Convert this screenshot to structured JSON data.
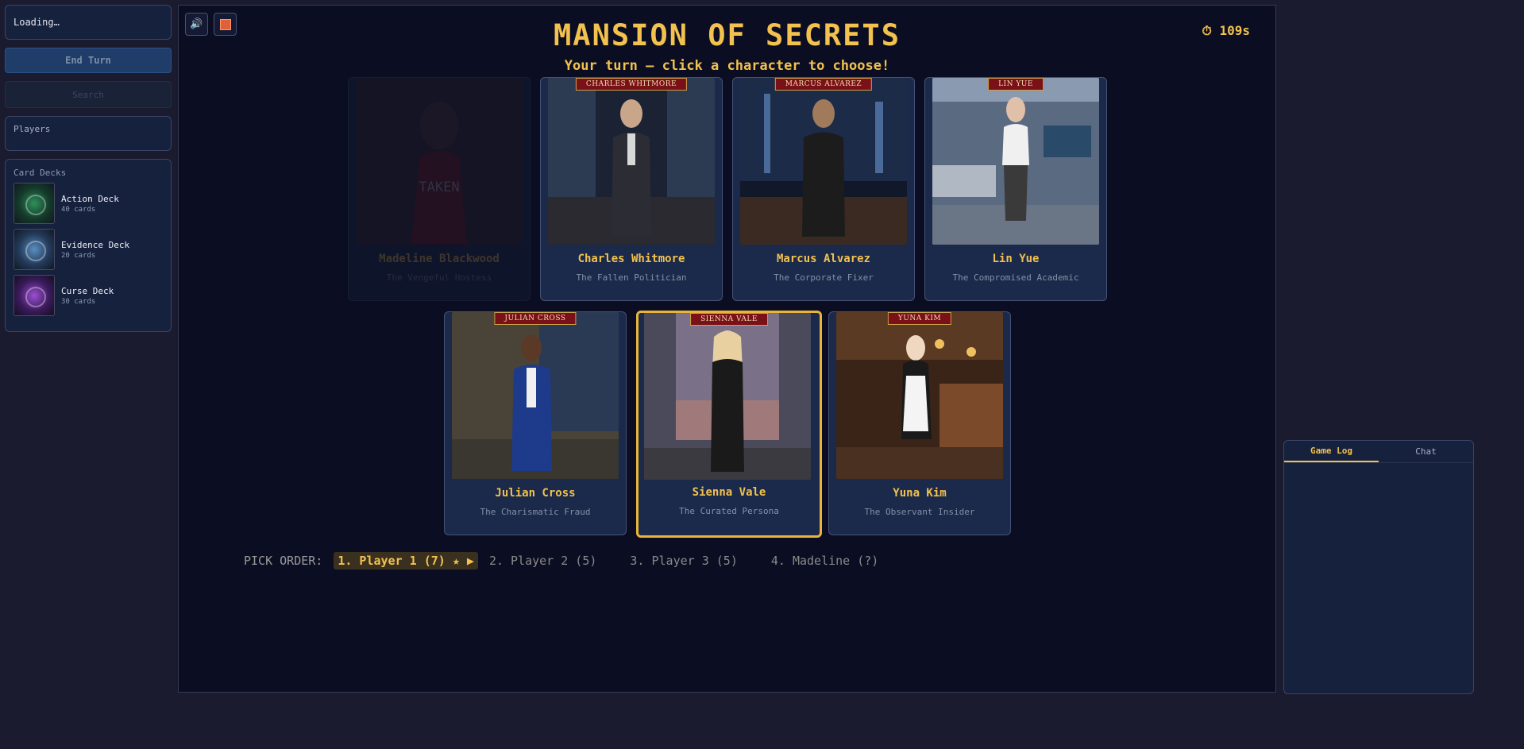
{
  "sidebar": {
    "status": "Loading…",
    "end_turn": "End Turn",
    "search_placeholder": "Search",
    "players_title": "Players",
    "decks_title": "Card Decks",
    "decks": [
      {
        "name": "Action Deck",
        "count": "40 cards",
        "icon": "action-deck-art"
      },
      {
        "name": "Evidence Deck",
        "count": "20 cards",
        "icon": "evidence-deck-art"
      },
      {
        "name": "Curse Deck",
        "count": "30 cards",
        "icon": "curse-deck-art"
      }
    ]
  },
  "controls": {
    "sound_icon": "🔊",
    "bomb_icon": "bomb-icon"
  },
  "game": {
    "title": "MANSION OF SECRETS",
    "prompt": "Your turn — click a character to choose!",
    "timer": "⏱ 109s",
    "taken_label": "TAKEN"
  },
  "characters": [
    {
      "name": "Madeline Blackwood",
      "subtitle": "The Vengeful Hostess",
      "plate": "",
      "state": "taken"
    },
    {
      "name": "Charles Whitmore",
      "subtitle": "The Fallen Politician",
      "plate": "CHARLES WHITMORE",
      "state": "available"
    },
    {
      "name": "Marcus Alvarez",
      "subtitle": "The Corporate Fixer",
      "plate": "MARCUS ALVAREZ",
      "state": "available"
    },
    {
      "name": "Lin Yue",
      "subtitle": "The Compromised Academic",
      "plate": "LIN YUE",
      "state": "available"
    },
    {
      "name": "Julian Cross",
      "subtitle": "The Charismatic Fraud",
      "plate": "JULIAN CROSS",
      "state": "available"
    },
    {
      "name": "Sienna Vale",
      "subtitle": "The Curated Persona",
      "plate": "SIENNA VALE",
      "state": "selected"
    },
    {
      "name": "Yuna Kim",
      "subtitle": "The Observant Insider",
      "plate": "YUNA KIM",
      "state": "available"
    }
  ],
  "pick_order": {
    "label": "PICK ORDER:",
    "items": [
      {
        "text": "1. Player 1 (7) ★ ▶",
        "active": true
      },
      {
        "text": "2. Player 2 (5)",
        "active": false
      },
      {
        "text": "3. Player 3 (5)",
        "active": false
      },
      {
        "text": "4. Madeline (?)",
        "active": false
      }
    ]
  },
  "log": {
    "tabs": [
      "Game Log",
      "Chat"
    ],
    "active_tab": "Game Log"
  },
  "colors": {
    "accent": "#f2c14e",
    "panel": "#16213e",
    "background": "#1b1b2f",
    "game_bg": "#0b0e22",
    "nameplate": "#7a1018"
  }
}
